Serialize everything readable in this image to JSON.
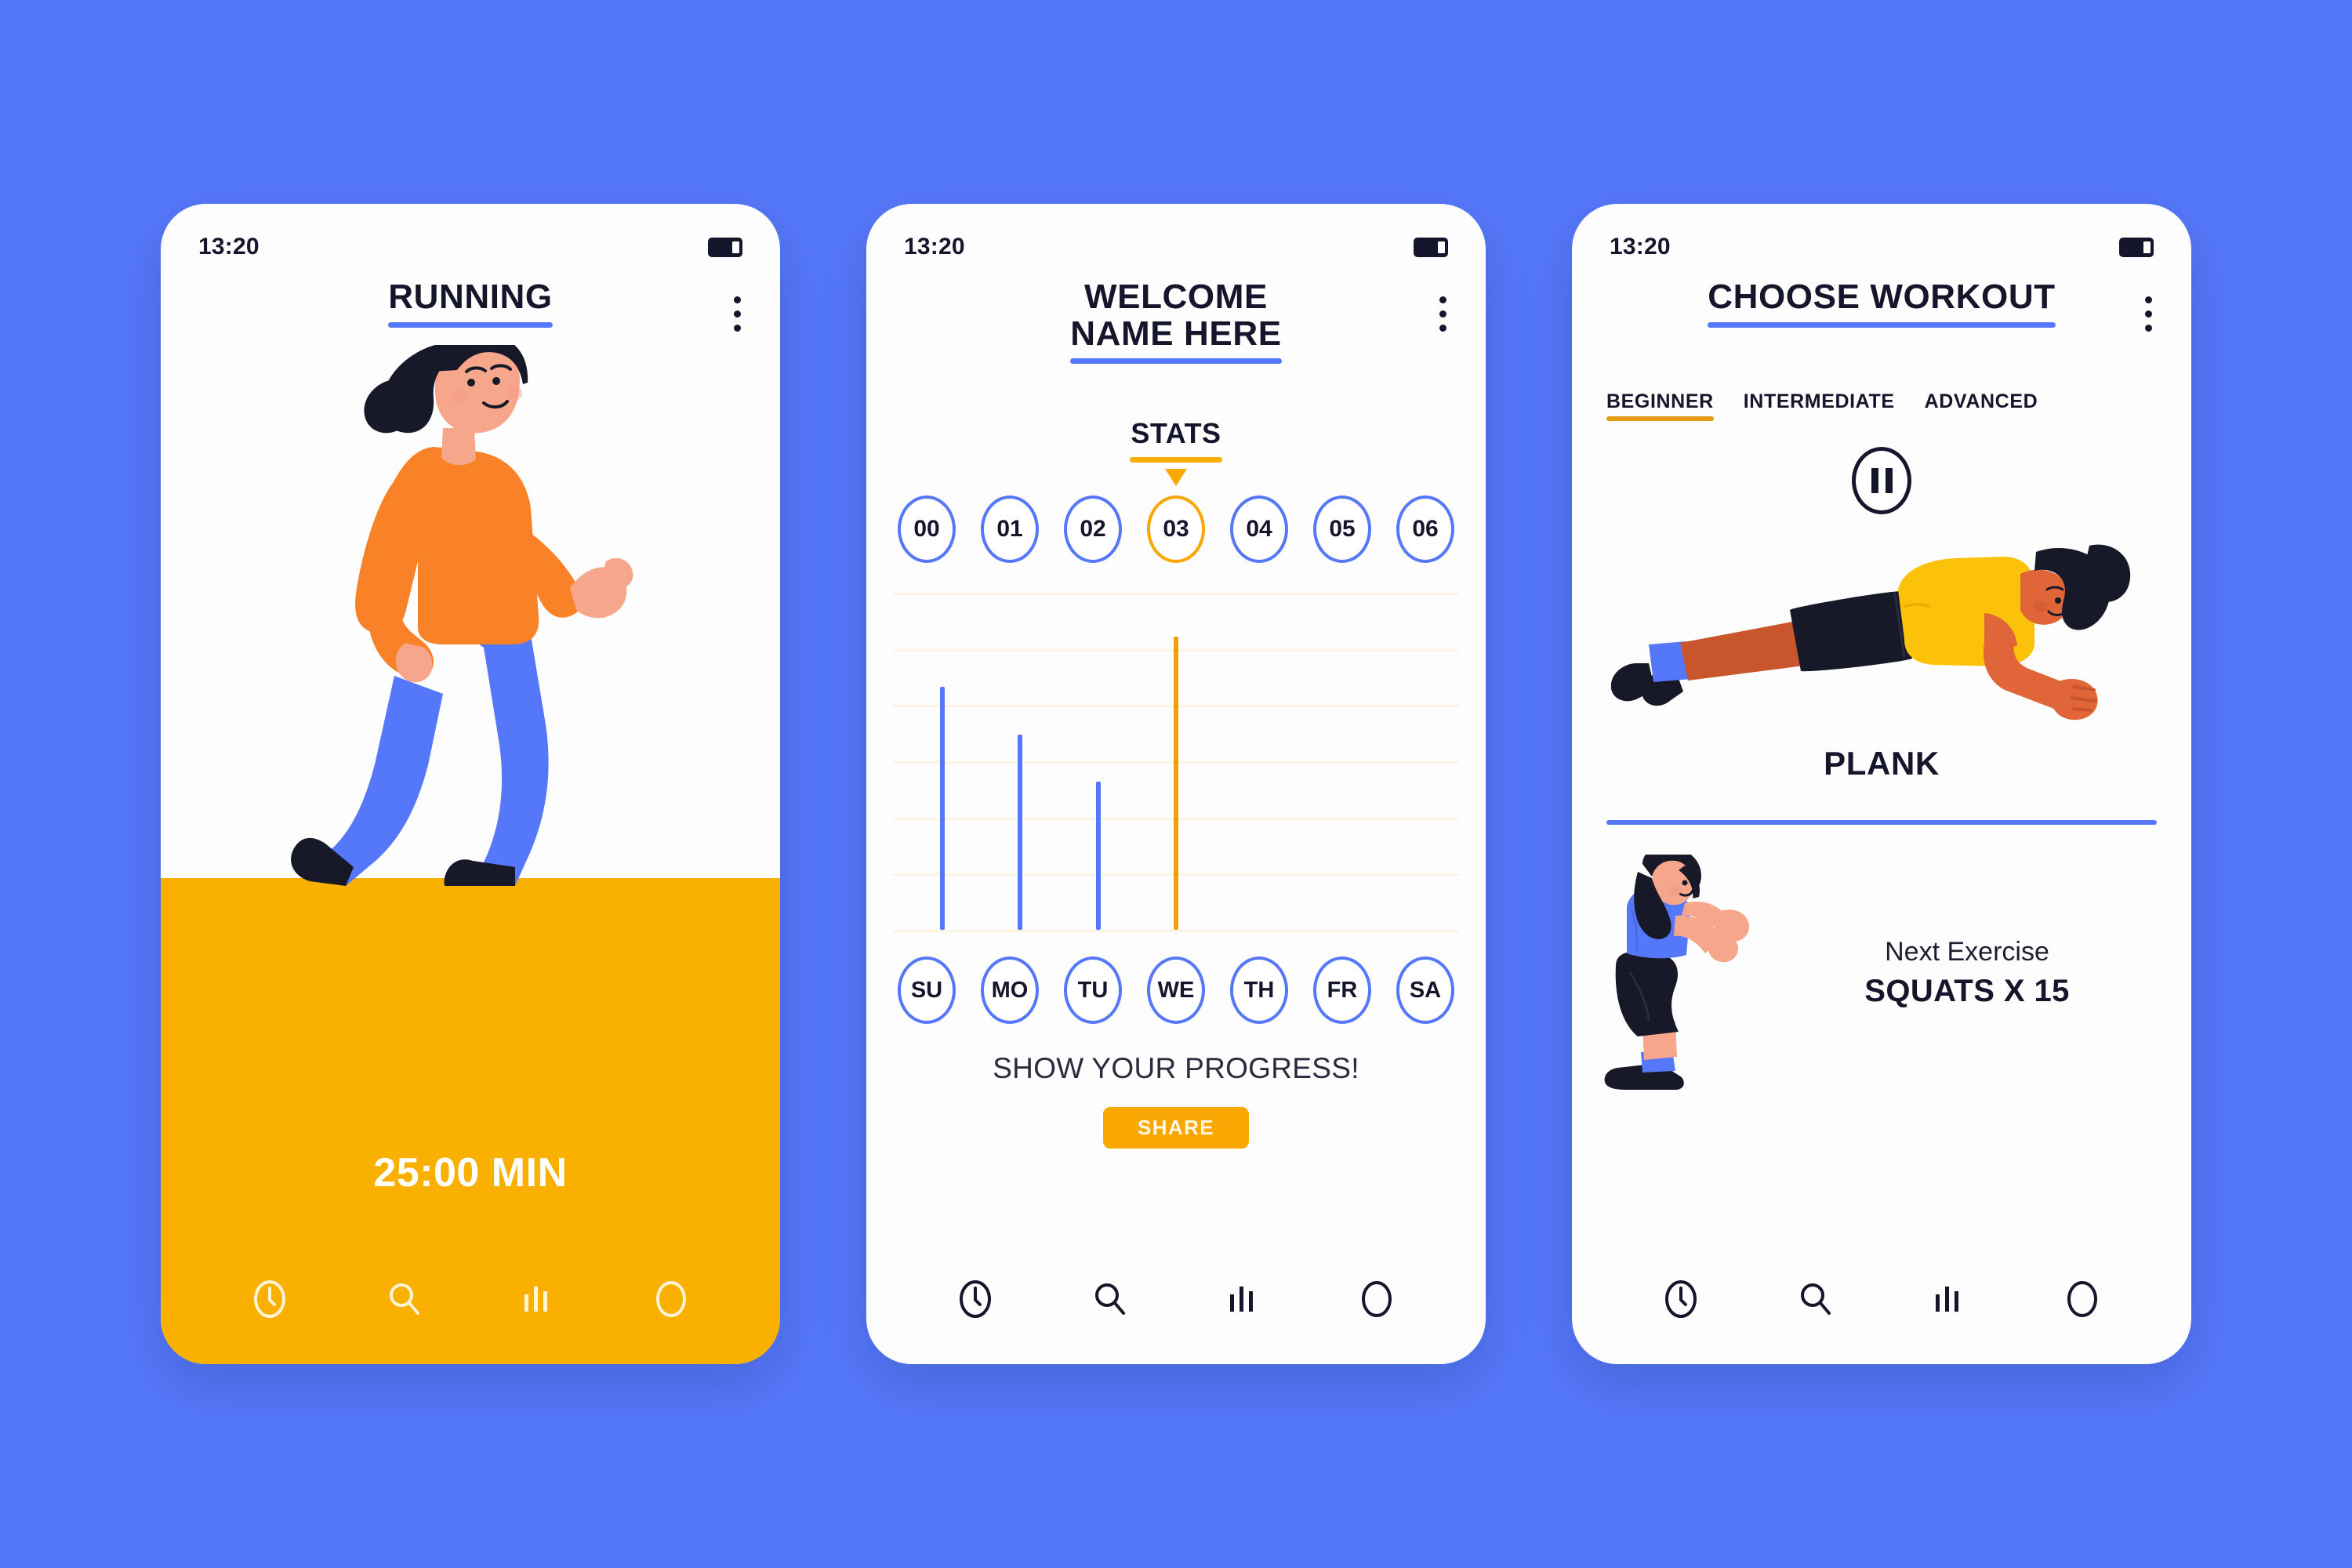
{
  "theme": {
    "background": "#5578fa",
    "accent_blue": "#5578fa",
    "accent_yellow": "#f9b001",
    "accent_orange": "#f9a703",
    "ink": "#15162c",
    "card": "#fdfdfd"
  },
  "screens": [
    {
      "id": "running",
      "status": {
        "time": "13:20",
        "battery_icon": "battery-icon"
      },
      "header": {
        "title": "RUNNING",
        "menu_icon": "kebab-menu-icon"
      },
      "illustration": "woman-running-illustration",
      "timer": "25:00 MIN",
      "nav": [
        {
          "icon": "clock-icon",
          "label": "Timer"
        },
        {
          "icon": "search-icon",
          "label": "Search"
        },
        {
          "icon": "bar-chart-icon",
          "label": "Stats"
        },
        {
          "icon": "circle-icon",
          "label": "Profile"
        }
      ]
    },
    {
      "id": "welcome",
      "status": {
        "time": "13:20",
        "battery_icon": "battery-icon"
      },
      "header": {
        "title": "WELCOME\nNAME HERE",
        "menu_icon": "kebab-menu-icon"
      },
      "stats_label": "STATS",
      "numbers": [
        "00",
        "01",
        "02",
        "03",
        "04",
        "05",
        "06"
      ],
      "selected_number": "03",
      "days": [
        "SU",
        "MO",
        "TU",
        "WE",
        "TH",
        "FR",
        "SA"
      ],
      "progress_text": "SHOW YOUR PROGRESS!",
      "share_label": "SHARE",
      "nav": [
        {
          "icon": "clock-icon",
          "label": "Timer"
        },
        {
          "icon": "search-icon",
          "label": "Search"
        },
        {
          "icon": "bar-chart-icon",
          "label": "Stats"
        },
        {
          "icon": "circle-icon",
          "label": "Profile"
        }
      ]
    },
    {
      "id": "choose-workout",
      "status": {
        "time": "13:20",
        "battery_icon": "battery-icon"
      },
      "header": {
        "title": "CHOOSE WORKOUT",
        "menu_icon": "kebab-menu-icon"
      },
      "levels": [
        "BEGINNER",
        "INTERMEDIATE",
        "ADVANCED"
      ],
      "selected_level": "BEGINNER",
      "pause_icon": "pause-icon",
      "illustration": "man-plank-illustration",
      "exercise_name": "PLANK",
      "next_illustration": "woman-squat-illustration",
      "next_label": "Next Exercise",
      "next_value": "SQUATS X 15",
      "nav": [
        {
          "icon": "clock-icon",
          "label": "Timer"
        },
        {
          "icon": "search-icon",
          "label": "Search"
        },
        {
          "icon": "bar-chart-icon",
          "label": "Stats"
        },
        {
          "icon": "circle-icon",
          "label": "Profile"
        }
      ]
    }
  ],
  "chart_data": {
    "type": "bar",
    "title": "STATS",
    "xlabel": "",
    "ylabel": "",
    "categories": [
      "SU",
      "MO",
      "TU",
      "WE",
      "TH",
      "FR",
      "SA"
    ],
    "values": [
      72,
      58,
      44,
      87,
      0,
      0,
      0
    ],
    "ylim": [
      0,
      100
    ],
    "grid": true,
    "gridlines": 7,
    "legend": "none",
    "bar_colors": [
      "#5578fa",
      "#5578fa",
      "#5578fa",
      "#f2a007",
      "#5578fa",
      "#5578fa",
      "#5578fa"
    ],
    "highlight_category": "WE"
  }
}
